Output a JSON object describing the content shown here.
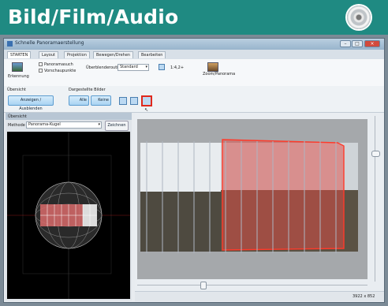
{
  "banner": {
    "title": "Bild/Film/Audio",
    "icon": "cd-icon"
  },
  "window": {
    "title": "Schnelle Panoramaerstellung"
  },
  "tabs": [
    "STARTEN",
    "Layout",
    "Projektion",
    "Bewegen/Drehen",
    "Bearbeiten"
  ],
  "ribbon": {
    "erkennung": "Erkennung",
    "check1": "Panoramasuch",
    "check2": "Vorschaupunkte",
    "mode_label": "Überblenderoutine",
    "mode_value": "Standard",
    "size_value": "1:4,2+",
    "zoom_label": "Zoom/Panorama",
    "group_label": "Übersicht",
    "group2_label": "Dargestellte Bilder"
  },
  "toolbar": {
    "show_hide": "Anzeigen / Ausblenden",
    "alle": "Alle",
    "keine": "Keine"
  },
  "leftpane": {
    "title": "Übersicht",
    "method_label": "Methode",
    "method_value": "Panorama-Kugel",
    "btn": "Zeichnen"
  },
  "statusbar": {
    "size": "3922 x 852"
  }
}
